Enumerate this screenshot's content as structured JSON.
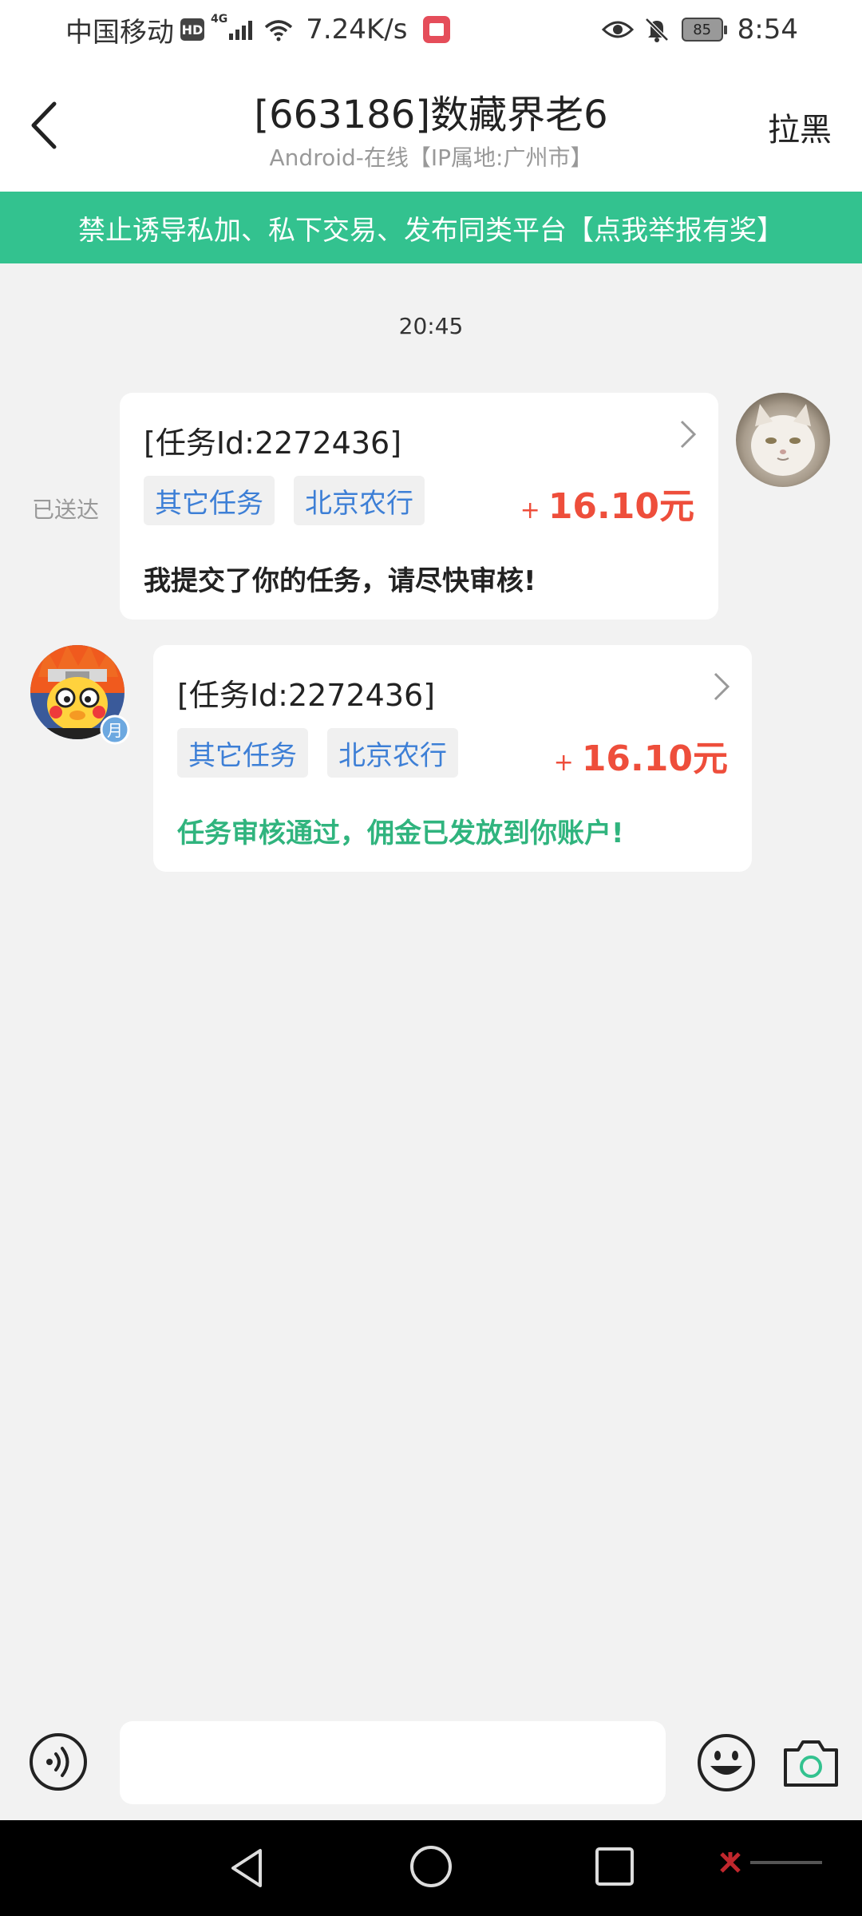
{
  "status_bar": {
    "carrier": "中国移动",
    "hd": "HD",
    "network": "4G",
    "speed": "7.24K/s",
    "battery": "85",
    "time": "8:54"
  },
  "header": {
    "title": "[663186]数藏界老6",
    "subtitle": "Android-在线【IP属地:广州市】",
    "block_label": "拉黑"
  },
  "banner": {
    "text": "禁止诱导私加、私下交易、发布同类平台【点我举报有奖】"
  },
  "chat": {
    "timestamp": "20:45",
    "delivered": "已送达",
    "messages": [
      {
        "title": "[任务Id:2272436]",
        "tags": [
          "其它任务",
          "北京农行"
        ],
        "amount_sign": "+",
        "amount": "16.10元",
        "text": "我提交了你的任务，请尽快审核!"
      },
      {
        "title": "[任务Id:2272436]",
        "tags": [
          "其它任务",
          "北京农行"
        ],
        "amount_sign": "+",
        "amount": "16.10元",
        "text": "任务审核通过，佣金已发放到你账户!"
      }
    ],
    "badge_text": "月"
  },
  "input": {
    "placeholder": ""
  },
  "icons": {
    "voice": "voice-icon",
    "emoji": "emoji-icon",
    "camera": "camera-icon"
  },
  "colors": {
    "banner": "#33c28f",
    "amount": "#ee4e3b",
    "tag_text": "#3d7fd6",
    "approved_text": "#30b47e"
  }
}
